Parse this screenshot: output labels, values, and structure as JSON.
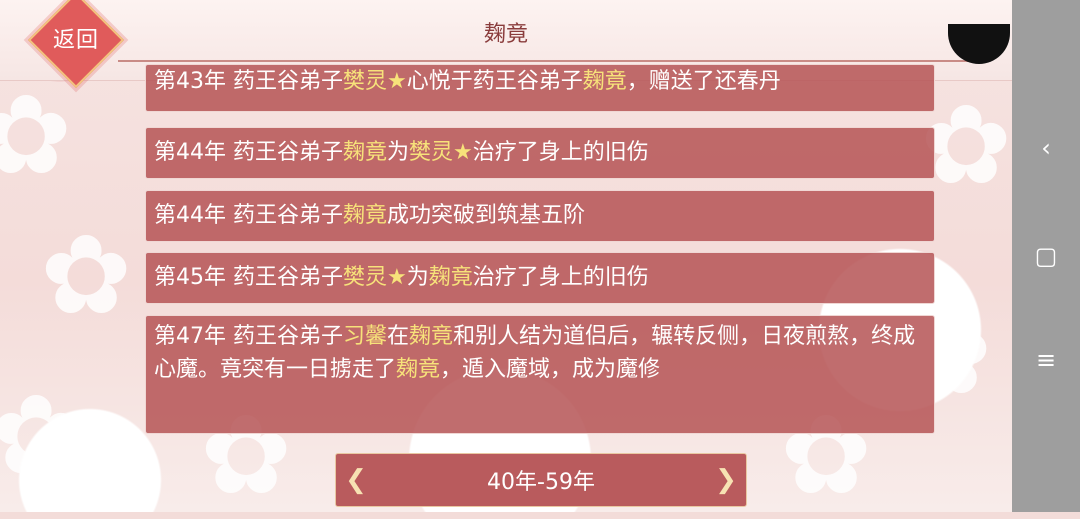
{
  "header": {
    "title": "麹竟",
    "back_label": "返回"
  },
  "entries": [
    {
      "year": "第43年",
      "text_parts": [
        "药王谷弟子",
        "樊灵★",
        "心悦于药王谷弟子",
        "麹竟",
        "，赠送了还春丹"
      ]
    },
    {
      "year": "第44年",
      "text_parts": [
        "药王谷弟子",
        "麹竟",
        "为",
        "樊灵★",
        "治疗了身上的旧伤"
      ]
    },
    {
      "year": "第44年",
      "text_parts": [
        "药王谷弟子",
        "麹竟",
        "成功突破到筑基五阶"
      ]
    },
    {
      "year": "第45年",
      "text_parts": [
        "药王谷弟子",
        "樊灵★",
        "为",
        "麹竟",
        "治疗了身上的旧伤"
      ]
    },
    {
      "year": "第47年",
      "text_parts": [
        "药王谷弟子",
        "习馨",
        "在",
        "麹竟",
        "和别人结为道侣后，辗转反侧，日夜煎熬，终成心魔。竟突有一日掳走了",
        "麹竟",
        "，遁入魔域，成为魔修"
      ]
    }
  ],
  "pagination": {
    "range_label": "40年-59年",
    "prev_icon": "left-ornament-arrow-icon",
    "next_icon": "right-ornament-arrow-icon"
  },
  "system_nav": {
    "back_icon": "‹",
    "home_icon": "▢",
    "menu_icon": "≡"
  },
  "colors": {
    "entry_bg": "#b55355",
    "highlight": "#f7e27a",
    "accent_red": "#e05b5b",
    "system_bar": "#9e9e9e"
  }
}
